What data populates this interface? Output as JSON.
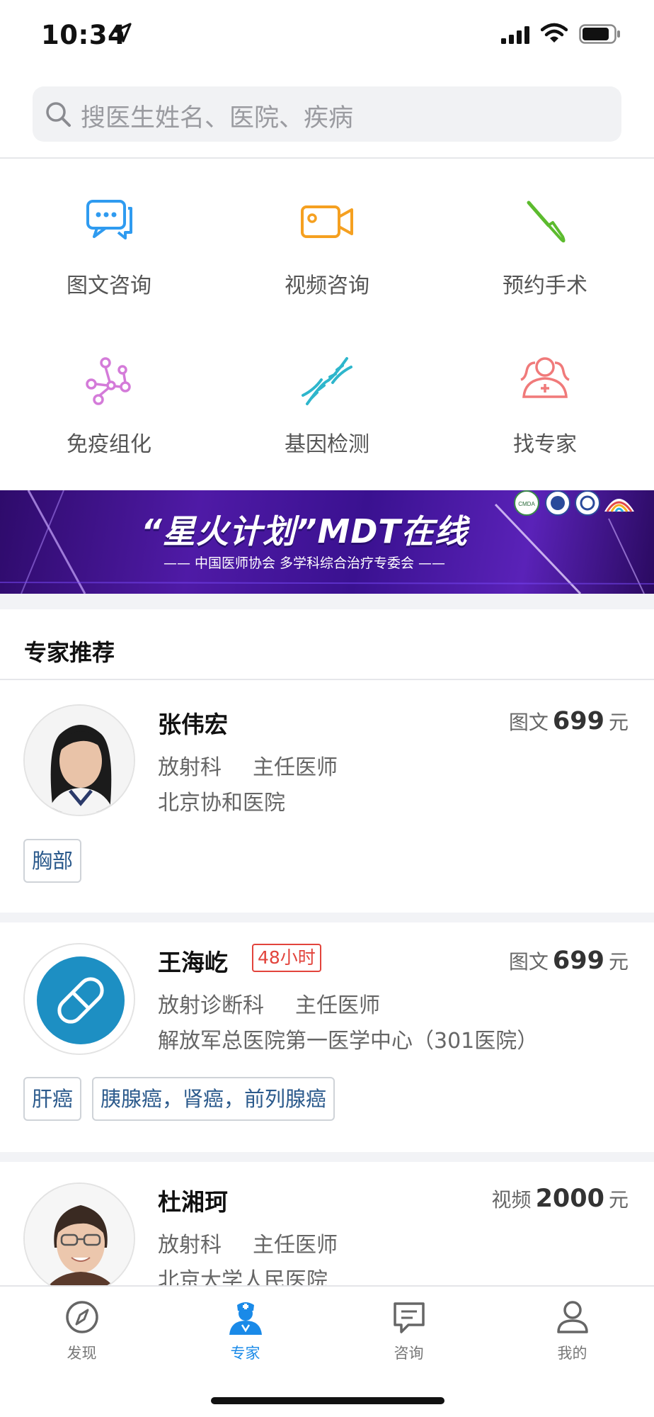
{
  "status_bar": {
    "time": "10:34"
  },
  "search": {
    "placeholder": "搜医生姓名、医院、疾病"
  },
  "services": [
    {
      "label": "图文咨询",
      "icon": "chat-bubble-icon",
      "color": "#2f9bf0"
    },
    {
      "label": "视频咨询",
      "icon": "video-camera-icon",
      "color": "#f5a020"
    },
    {
      "label": "预约手术",
      "icon": "scalpel-icon",
      "color": "#5cbb2e"
    },
    {
      "label": "免疫组化",
      "icon": "molecule-icon",
      "color": "#d47bd9"
    },
    {
      "label": "基因检测",
      "icon": "dna-icon",
      "color": "#2eb6cc"
    },
    {
      "label": "找专家",
      "icon": "doctor-group-icon",
      "color": "#f07a7a"
    }
  ],
  "banner": {
    "title": "“星火计划”MDT在线",
    "subtitle": "—— 中国医师协会 多学科综合治疗专委会 ——",
    "logo_text": "CMDA"
  },
  "section": {
    "title": "专家推荐"
  },
  "doctors": [
    {
      "name": "张伟宏",
      "dept": "放射科",
      "title": "主任医师",
      "hospital": "北京协和医院",
      "price_type": "图文",
      "price": "699",
      "unit": "元",
      "badge": "",
      "tags": [
        "胸部"
      ]
    },
    {
      "name": "王海屹",
      "dept": "放射诊断科",
      "title": "主任医师",
      "hospital": "解放军总医院第一医学中心（301医院）",
      "price_type": "图文",
      "price": "699",
      "unit": "元",
      "badge": "48小时",
      "tags": [
        "肝癌",
        "胰腺癌，肾癌，前列腺癌"
      ]
    },
    {
      "name": "杜湘珂",
      "dept": "放射科",
      "title": "主任医师",
      "hospital": "北京大学人民医院",
      "price_type": "视频",
      "price": "2000",
      "unit": "元",
      "badge": "",
      "tags": []
    }
  ],
  "tabbar": [
    {
      "label": "发现",
      "icon": "compass-icon",
      "active": false
    },
    {
      "label": "专家",
      "icon": "doctor-icon",
      "active": true
    },
    {
      "label": "咨询",
      "icon": "message-icon",
      "active": false
    },
    {
      "label": "我的",
      "icon": "person-icon",
      "active": false
    }
  ],
  "colors": {
    "accent": "#1a8ae8",
    "badge_red": "#e2443c",
    "tag_text": "#2b5a8c"
  }
}
